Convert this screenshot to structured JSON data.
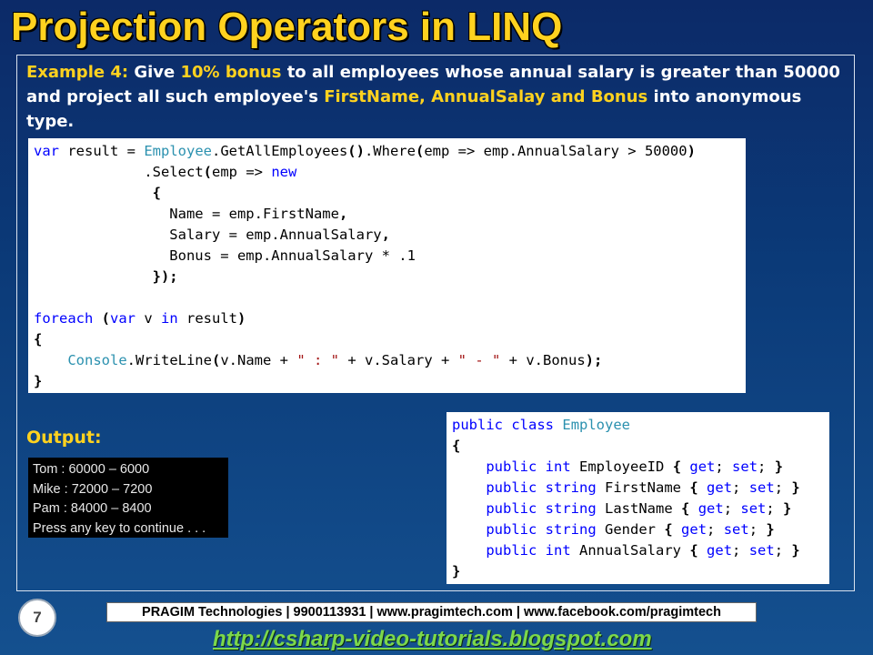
{
  "slide": {
    "title": "Projection Operators in LINQ",
    "page_number": "7"
  },
  "example": {
    "label": "Example 4:",
    "text_1": " Give ",
    "highlight_1": "10% bonus",
    "text_2": " to all employees whose annual salary is greater than 50000 and project all such employee's ",
    "highlight_2": "FirstName, AnnualSalay and Bonus",
    "text_3": " into anonymous type."
  },
  "code_main": {
    "l1_kw": "var",
    "l1_a": " result = ",
    "l1_type": "Employee",
    "l1_b": ".GetAllEmployees",
    "l1_c": "()",
    "l1_d": ".Where",
    "l1_e": "(",
    "l1_f": "emp => emp.AnnualSalary > 50000",
    "l1_g": ")",
    "l2_indent": "             ",
    "l2_a": ".Select",
    "l2_b": "(",
    "l2_c": "emp => ",
    "l2_kw": "new",
    "l3": "              {",
    "l4_a": "                Name = emp.FirstName",
    "l4_b": ",",
    "l5_a": "                Salary = emp.AnnualSalary",
    "l5_b": ",",
    "l6": "                Bonus = emp.AnnualSalary * .1",
    "l7": "              });",
    "l9_kw1": "foreach",
    "l9_a": " ",
    "l9_b": "(",
    "l9_kw2": "var",
    "l9_c": " v ",
    "l9_kw3": "in",
    "l9_d": " result",
    "l9_e": ")",
    "l10": "{",
    "l11_indent": "    ",
    "l11_type": "Console",
    "l11_a": ".WriteLine",
    "l11_b": "(",
    "l11_c": "v.Name + ",
    "l11_s1": "\" : \"",
    "l11_d": " + v.Salary + ",
    "l11_s2": "\" - \"",
    "l11_e": " + v.Bonus",
    "l11_f": ");",
    "l12": "}"
  },
  "output": {
    "label": "Output:",
    "lines": [
      "Tom : 60000 – 6000",
      "Mike : 72000 – 7200",
      "Pam : 84000 – 8400",
      "Press any key to continue . . ."
    ]
  },
  "code_class": {
    "public": "public",
    "class": "class",
    "name": "Employee",
    "open": "{",
    "close": "}",
    "get_set": "{ get; set; }",
    "props": [
      {
        "type": "int",
        "name": "EmployeeID"
      },
      {
        "type": "string",
        "name": "FirstName"
      },
      {
        "type": "string",
        "name": "LastName"
      },
      {
        "type": "string",
        "name": "Gender"
      },
      {
        "type": "int",
        "name": "AnnualSalary"
      }
    ]
  },
  "footer": {
    "text": "PRAGIM Technologies | 9900113931 | www.pragimtech.com | www.facebook.com/pragimtech",
    "blog_url": "http://csharp-video-tutorials.blogspot.com"
  },
  "colors": {
    "title": "#ffd21f",
    "highlight": "#ffd21f",
    "keyword": "#0000ff",
    "type": "#2b91af",
    "string": "#a31515",
    "link": "#7cd84b"
  }
}
